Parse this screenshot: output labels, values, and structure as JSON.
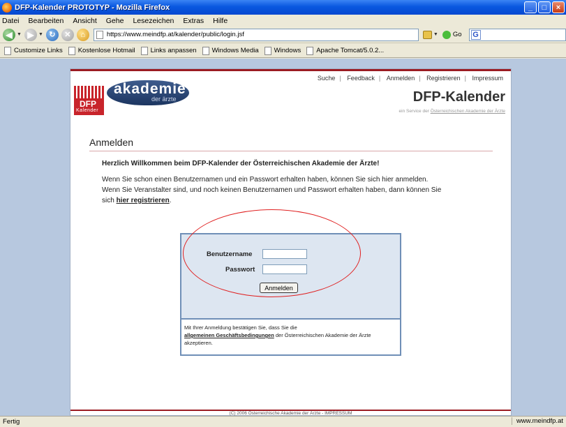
{
  "window": {
    "title": "DFP-Kalender PROTOTYP - Mozilla Firefox",
    "buttons": [
      "_",
      "□",
      "×"
    ]
  },
  "menubar": [
    "Datei",
    "Bearbeiten",
    "Ansicht",
    "Gehe",
    "Lesezeichen",
    "Extras",
    "Hilfe"
  ],
  "navbar": {
    "url": "https://www.meindfp.at/kalender/public/login.jsf",
    "go_label": "Go",
    "search_placeholder": ""
  },
  "bookmarks": [
    "Customize Links",
    "Kostenlose Hotmail",
    "Links anpassen",
    "Windows Media",
    "Windows",
    "Apache Tomcat/5.0.2..."
  ],
  "site": {
    "logo_dfp_text": "DFP",
    "logo_dfp_sub": "Kalender",
    "logo_akademie": "akademie",
    "logo_akademie_sub": "der ärzte",
    "topnav": [
      "Suche",
      "Feedback",
      "Anmelden",
      "Registrieren",
      "Impressum"
    ],
    "brand": "DFP-Kalender",
    "tagline_prefix": "ein Service der ",
    "tagline_link": "Österreichischen Akademie der Ärzte"
  },
  "login_page": {
    "heading": "Anmelden",
    "welcome": "Herzlich Willkommen beim DFP-Kalender der Österreichischen Akademie der Ärzte!",
    "para_line1": "Wenn Sie schon einen Benutzernamen und ein Passwort erhalten haben, können Sie sich hier anmelden.",
    "para_line2": "Wenn Sie Veranstalter sind, und noch keinen Benutzernamen und Passwort erhalten haben, dann können Sie",
    "para_line3_prefix": "sich ",
    "register_link": "hier registrieren",
    "para_line3_suffix": ".",
    "username_label": "Benutzername",
    "username_value": "",
    "password_label": "Passwort",
    "password_value": "",
    "login_button": "Anmelden",
    "terms_prefix": "Mit Ihrer Anmeldung bestätigen Sie, dass Sie die",
    "terms_link": "allgemeinen Geschäftsbedingungen",
    "terms_suffix": " der Österreichischen Akademie der Ärzte akzeptieren."
  },
  "footer": "(C) 2006 Österreichische Akademie der Ärzte - IMPRESSUM",
  "statusbar": {
    "left": "Fertig",
    "right": "www.meindfp.at"
  },
  "colors": {
    "page_bg": "#b7c8df",
    "accent_red": "#9b1b22",
    "login_panel": "#dde6f1",
    "annotation_ellipse": "#e02020"
  }
}
